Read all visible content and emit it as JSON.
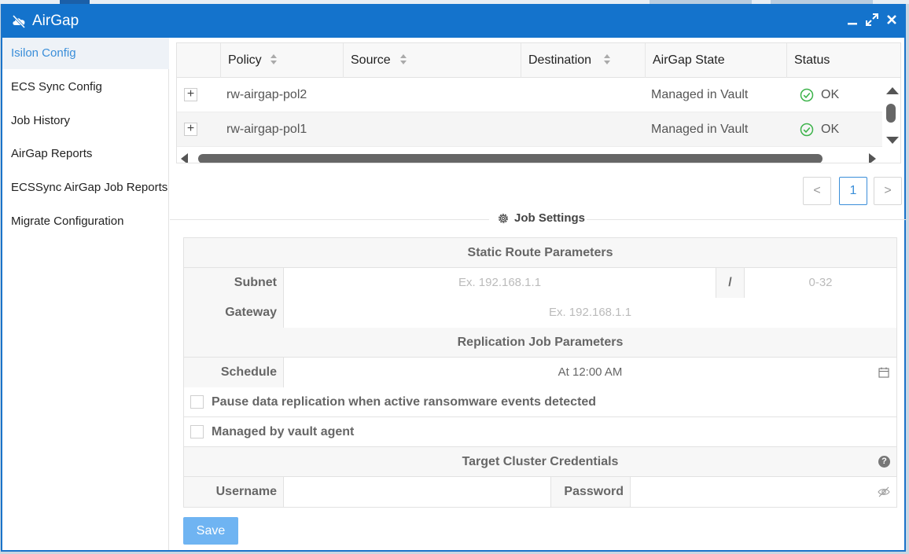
{
  "window": {
    "title": "AirGap"
  },
  "sidebar": {
    "items": [
      {
        "label": "Isilon Config",
        "active": true
      },
      {
        "label": "ECS Sync Config"
      },
      {
        "label": "Job History"
      },
      {
        "label": "AirGap Reports"
      },
      {
        "label": "ECSSync AirGap Job Reports"
      },
      {
        "label": "Migrate Configuration"
      }
    ]
  },
  "table": {
    "columns": [
      "Policy",
      "Source",
      "Destination",
      "AirGap State",
      "Status"
    ],
    "rows": [
      {
        "policy": "rw-airgap-pol2",
        "source": "",
        "destination": "",
        "airgap_state": "Managed in Vault",
        "status": "OK"
      },
      {
        "policy": "rw-airgap-pol1",
        "source": "",
        "destination": "",
        "airgap_state": "Managed in Vault",
        "status": "OK"
      }
    ]
  },
  "pagination": {
    "prev": "<",
    "current": "1",
    "next": ">"
  },
  "job_settings": {
    "title": "Job Settings",
    "static_route": {
      "title": "Static Route Parameters",
      "subnet_label": "Subnet",
      "subnet_placeholder": "Ex. 192.168.1.1",
      "slash": "/",
      "prefix_placeholder": "0-32",
      "gateway_label": "Gateway",
      "gateway_placeholder": "Ex. 192.168.1.1"
    },
    "replication": {
      "title": "Replication Job Parameters",
      "schedule_label": "Schedule",
      "schedule_value": "At 12:00 AM",
      "pause_label": "Pause data replication when active ransomware events detected",
      "managed_label": "Managed by vault agent"
    },
    "credentials": {
      "title": "Target Cluster Credentials",
      "help": "?",
      "username_label": "Username",
      "username_value": "",
      "password_label": "Password",
      "password_value": ""
    },
    "save_label": "Save"
  },
  "colors": {
    "titlebar": "#1473cc",
    "accent": "#3a8ed9",
    "ok": "#3cb34a",
    "save": "#6fb4f2"
  }
}
